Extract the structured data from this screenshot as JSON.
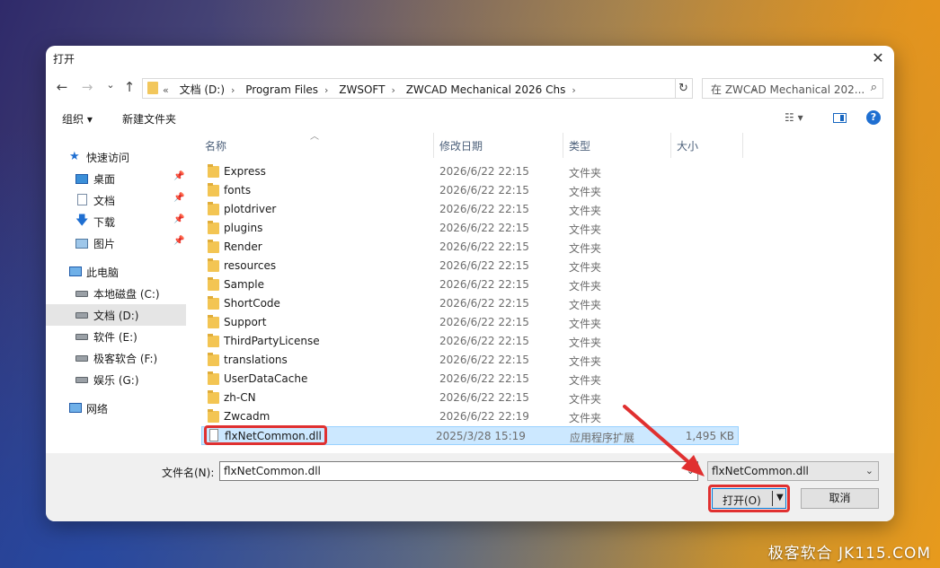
{
  "dialog": {
    "title": "打开",
    "close": "✕"
  },
  "nav": {
    "back": "←",
    "forward": "→",
    "recent": "⌄",
    "up": "↑"
  },
  "address": {
    "chevron": "«",
    "crumbs": [
      "文档 (D:)",
      "Program Files",
      "ZWSOFT",
      "ZWCAD Mechanical 2026 Chs"
    ],
    "separator": "›",
    "dropdown": "⌄",
    "refresh": "↻"
  },
  "search": {
    "placeholder": "在 ZWCAD Mechanical 202...",
    "icon": "⌕"
  },
  "toolbar": {
    "organize": "组织 ▾",
    "new_folder": "新建文件夹",
    "view": "☷ ▾",
    "help": "?"
  },
  "sidebar": {
    "items": [
      {
        "label": "快速访问",
        "icon": "star-icon",
        "pinned": false
      },
      {
        "label": "桌面",
        "icon": "desktop-icon",
        "pinned": true
      },
      {
        "label": "文档",
        "icon": "document-icon",
        "pinned": true
      },
      {
        "label": "下载",
        "icon": "download-icon",
        "pinned": true
      },
      {
        "label": "图片",
        "icon": "pictures-icon",
        "pinned": true
      },
      {
        "label": "此电脑",
        "icon": "computer-icon",
        "pinned": false
      },
      {
        "label": "本地磁盘 (C:)",
        "icon": "drive-icon",
        "pinned": false
      },
      {
        "label": "文档 (D:)",
        "icon": "drive-icon",
        "pinned": false,
        "selected": true
      },
      {
        "label": "软件 (E:)",
        "icon": "drive-icon",
        "pinned": false
      },
      {
        "label": "极客软合 (F:)",
        "icon": "drive-icon",
        "pinned": false
      },
      {
        "label": "娱乐 (G:)",
        "icon": "drive-icon",
        "pinned": false
      },
      {
        "label": "网络",
        "icon": "network-icon",
        "pinned": false
      }
    ]
  },
  "columns": {
    "name": "名称",
    "date": "修改日期",
    "type": "类型",
    "size": "大小"
  },
  "files": [
    {
      "name": "Express",
      "date": "2026/6/22 22:15",
      "type": "文件夹",
      "size": ""
    },
    {
      "name": "fonts",
      "date": "2026/6/22 22:15",
      "type": "文件夹",
      "size": ""
    },
    {
      "name": "plotdriver",
      "date": "2026/6/22 22:15",
      "type": "文件夹",
      "size": ""
    },
    {
      "name": "plugins",
      "date": "2026/6/22 22:15",
      "type": "文件夹",
      "size": ""
    },
    {
      "name": "Render",
      "date": "2026/6/22 22:15",
      "type": "文件夹",
      "size": ""
    },
    {
      "name": "resources",
      "date": "2026/6/22 22:15",
      "type": "文件夹",
      "size": ""
    },
    {
      "name": "Sample",
      "date": "2026/6/22 22:15",
      "type": "文件夹",
      "size": ""
    },
    {
      "name": "ShortCode",
      "date": "2026/6/22 22:15",
      "type": "文件夹",
      "size": ""
    },
    {
      "name": "Support",
      "date": "2026/6/22 22:15",
      "type": "文件夹",
      "size": ""
    },
    {
      "name": "ThirdPartyLicense",
      "date": "2026/6/22 22:15",
      "type": "文件夹",
      "size": ""
    },
    {
      "name": "translations",
      "date": "2026/6/22 22:15",
      "type": "文件夹",
      "size": ""
    },
    {
      "name": "UserDataCache",
      "date": "2026/6/22 22:15",
      "type": "文件夹",
      "size": ""
    },
    {
      "name": "zh-CN",
      "date": "2026/6/22 22:15",
      "type": "文件夹",
      "size": ""
    },
    {
      "name": "Zwcadm",
      "date": "2026/6/22 22:19",
      "type": "文件夹",
      "size": ""
    },
    {
      "name": "flxNetCommon.dll",
      "date": "2025/3/28 15:19",
      "type": "应用程序扩展",
      "size": "1,495 KB",
      "selected": true
    }
  ],
  "footer": {
    "filename_label": "文件名(N):",
    "filename_value": "flxNetCommon.dll",
    "filetype_value": "flxNetCommon.dll",
    "dropdown": "⌄",
    "open_label": "打开(O)",
    "open_arrow": "▼",
    "cancel_label": "取消"
  },
  "watermark": "极客软合 JK115.COM",
  "colors": {
    "highlight": "#e03030",
    "selection": "#cce8ff",
    "accent": "#0078d7"
  }
}
